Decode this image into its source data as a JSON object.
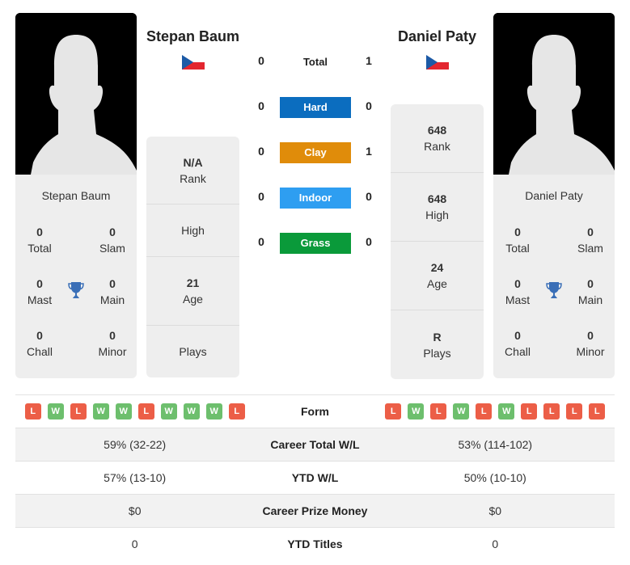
{
  "players": [
    {
      "name": "Stepan Baum",
      "country": "Czech Republic",
      "card": {
        "name": "Stepan Baum",
        "titles": [
          {
            "value": "0",
            "label": "Total"
          },
          {
            "value": "0",
            "label": "Slam"
          },
          {
            "value": "0",
            "label": "Mast"
          },
          {
            "value": "0",
            "label": "Main"
          },
          {
            "value": "0",
            "label": "Chall"
          },
          {
            "value": "0",
            "label": "Minor"
          }
        ]
      },
      "info": [
        {
          "value": "N/A",
          "label": "Rank"
        },
        {
          "value": "",
          "label": "High"
        },
        {
          "value": "21",
          "label": "Age"
        },
        {
          "value": "",
          "label": "Plays"
        }
      ],
      "form": [
        "L",
        "W",
        "L",
        "W",
        "W",
        "L",
        "W",
        "W",
        "W",
        "L"
      ],
      "career_wl": "59% (32-22)",
      "ytd_wl": "57% (13-10)",
      "career_prize": "$0",
      "ytd_titles": "0"
    },
    {
      "name": "Daniel Paty",
      "country": "Czech Republic",
      "card": {
        "name": "Daniel Paty",
        "titles": [
          {
            "value": "0",
            "label": "Total"
          },
          {
            "value": "0",
            "label": "Slam"
          },
          {
            "value": "0",
            "label": "Mast"
          },
          {
            "value": "0",
            "label": "Main"
          },
          {
            "value": "0",
            "label": "Chall"
          },
          {
            "value": "0",
            "label": "Minor"
          }
        ]
      },
      "info": [
        {
          "value": "648",
          "label": "Rank"
        },
        {
          "value": "648",
          "label": "High"
        },
        {
          "value": "24",
          "label": "Age"
        },
        {
          "value": "R",
          "label": "Plays"
        }
      ],
      "form": [
        "L",
        "W",
        "L",
        "W",
        "L",
        "W",
        "L",
        "L",
        "L",
        "L"
      ],
      "career_wl": "53% (114-102)",
      "ytd_wl": "50% (10-10)",
      "career_prize": "$0",
      "ytd_titles": "0"
    }
  ],
  "h2h": [
    {
      "label": "Total",
      "p1": "0",
      "p2": "1",
      "color": null
    },
    {
      "label": "Hard",
      "p1": "0",
      "p2": "0",
      "color": "#0b6dbf"
    },
    {
      "label": "Clay",
      "p1": "0",
      "p2": "1",
      "color": "#e08c0a"
    },
    {
      "label": "Indoor",
      "p1": "0",
      "p2": "0",
      "color": "#2e9ef1"
    },
    {
      "label": "Grass",
      "p1": "0",
      "p2": "0",
      "color": "#0a9a3a"
    }
  ],
  "table_labels": {
    "form": "Form",
    "career_wl": "Career Total W/L",
    "ytd_wl": "YTD W/L",
    "career_prize": "Career Prize Money",
    "ytd_titles": "YTD Titles"
  },
  "colors": {
    "trophy": "#3a6fb7",
    "win": "#6dbf6d",
    "loss": "#ec5e47",
    "card_bg": "#eeeeee"
  }
}
